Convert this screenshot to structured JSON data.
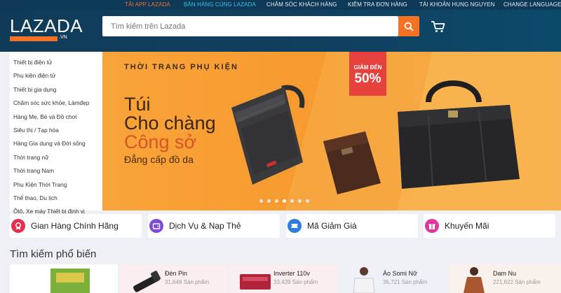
{
  "topbar": {
    "app": "TẢI APP LAZADA",
    "sell": "BÁN HÀNG CÙNG LAZADA",
    "support": "CHĂM SÓC KHÁCH HÀNG",
    "track": "KIỂM TRA ĐƠN HÀNG",
    "account": "TÀI KHOẢN HUNG NGUYEN",
    "lang": "CHANGE LANGUAGE"
  },
  "logo": {
    "text": "LAZADA",
    "suffix": ".VN"
  },
  "search": {
    "placeholder": "Tìm kiếm trên Lazada"
  },
  "icons": {
    "search": "search-icon",
    "cart": "cart-icon"
  },
  "sidebar": {
    "items": [
      {
        "label": "Thiết bị điện tử"
      },
      {
        "label": "Phụ kiện điện tử"
      },
      {
        "label": "Thiết bị gia dụng"
      },
      {
        "label": "Chăm sóc sức khỏe, Làmđẹp"
      },
      {
        "label": "Hàng Mẹ, Bé và Đồ chơi"
      },
      {
        "label": "Siêu thị / Tạp hóa"
      },
      {
        "label": "Hàng Gia dụng và Đời sống"
      },
      {
        "label": "Thời trang nữ"
      },
      {
        "label": "Thời trang Nam"
      },
      {
        "label": "Phụ Kiện Thời Trang"
      },
      {
        "label": "Thể thao, Du lịch"
      },
      {
        "label": "Ôtô, Xe máy Thiết bị định vị"
      }
    ]
  },
  "banner": {
    "subtitle": "THỜI TRANG PHỤ KIỆN",
    "line1": "Túi",
    "line2": "Cho chàng",
    "line3": "Công sở",
    "tagline": "Đẳng cấp đồ da",
    "badge_top": "GIẢM ĐẾN",
    "badge_value": "50%",
    "slides": 7,
    "active_slide": 3
  },
  "quick": [
    {
      "label": "Gian Hàng Chính Hãng",
      "color": "#e62e4d",
      "icon": "badge-icon"
    },
    {
      "label": "Dịch Vụ & Nạp Thẻ",
      "color": "#7d4bd8",
      "icon": "wallet-icon"
    },
    {
      "label": "Mã Giảm Giá",
      "color": "#2f7de1",
      "icon": "coupon-icon"
    },
    {
      "label": "Khuyến Mãi",
      "color": "#e0389a",
      "icon": "gift-icon"
    }
  ],
  "popular": {
    "title": "Tìm kiếm phổ biến",
    "cards": [
      {
        "name": "",
        "count": ""
      },
      {
        "name": "Đèn Pin",
        "count": "31,648 Sản phẩm"
      },
      {
        "name": "Inverter 110v",
        "count": "33,439 Sản phẩm"
      },
      {
        "name": "Áo Somi Nữ",
        "count": "36,721 Sản phẩm"
      },
      {
        "name": "Dam Nu",
        "count": "221,622 Sản phẩm"
      }
    ]
  },
  "colors": {
    "accent": "#f57224",
    "header": "#0f3a57",
    "topbar_highlight": "#f57224",
    "topbar_link": "#37c2e8"
  }
}
